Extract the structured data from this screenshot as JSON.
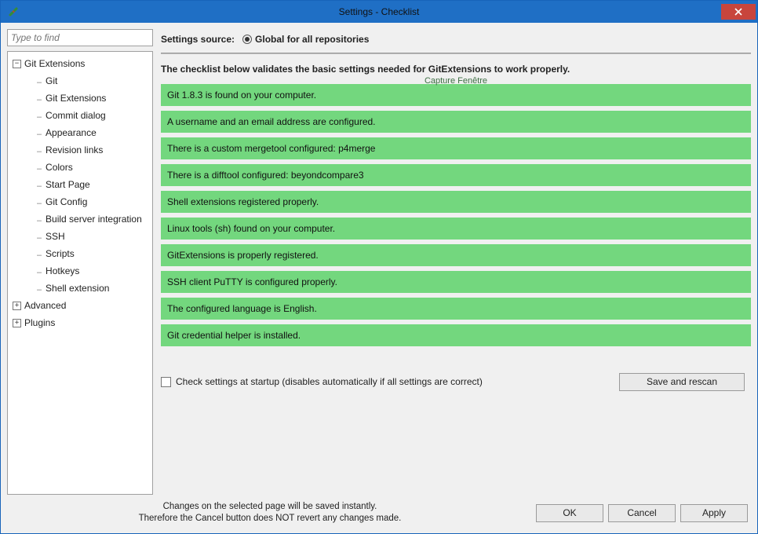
{
  "window": {
    "title": "Settings - Checklist",
    "close_tooltip": "Close"
  },
  "sidebar": {
    "search_placeholder": "Type to find",
    "nodes": [
      {
        "label": "Git Extensions",
        "depth": 0,
        "expander": "-",
        "has_children": true
      },
      {
        "label": "Git",
        "depth": 2,
        "leaf": true
      },
      {
        "label": "Git Extensions",
        "depth": 2,
        "leaf": true
      },
      {
        "label": "Commit dialog",
        "depth": 2,
        "leaf": true
      },
      {
        "label": "Appearance",
        "depth": 2,
        "leaf": true
      },
      {
        "label": "Revision links",
        "depth": 2,
        "leaf": true
      },
      {
        "label": "Colors",
        "depth": 2,
        "leaf": true
      },
      {
        "label": "Start Page",
        "depth": 2,
        "leaf": true
      },
      {
        "label": "Git Config",
        "depth": 2,
        "leaf": true
      },
      {
        "label": "Build server integration",
        "depth": 2,
        "leaf": true
      },
      {
        "label": "SSH",
        "depth": 2,
        "leaf": true
      },
      {
        "label": "Scripts",
        "depth": 2,
        "leaf": true
      },
      {
        "label": "Hotkeys",
        "depth": 2,
        "leaf": true
      },
      {
        "label": "Shell extension",
        "depth": 2,
        "leaf": true
      },
      {
        "label": "Advanced",
        "depth": 1,
        "expander": "+",
        "has_children": true
      },
      {
        "label": "Plugins",
        "depth": 0,
        "expander": "+",
        "has_children": true
      }
    ]
  },
  "source": {
    "label": "Settings source:",
    "option": "Global for all repositories"
  },
  "intro": "The checklist below validates the basic settings needed for GitExtensions to work properly.",
  "ghost_text": "Capture Fenêtre",
  "checks": [
    "Git 1.8.3 is found on your computer.",
    "A username and an email address are configured.",
    "There is a custom mergetool configured: p4merge",
    "There is a difftool configured: beyondcompare3",
    "Shell extensions registered properly.",
    "Linux tools (sh) found on your computer.",
    "GitExtensions is properly registered.",
    "SSH client PuTTY is configured properly.",
    "The configured language is English.",
    "Git credential helper is installed."
  ],
  "startup": {
    "label": "Check settings at startup (disables automatically if all settings are correct)",
    "rescan_label": "Save and rescan"
  },
  "footer": {
    "note1": "Changes on the selected page will be saved instantly.",
    "note2": "Therefore the Cancel button does NOT revert any changes made.",
    "ok": "OK",
    "cancel": "Cancel",
    "apply": "Apply"
  }
}
